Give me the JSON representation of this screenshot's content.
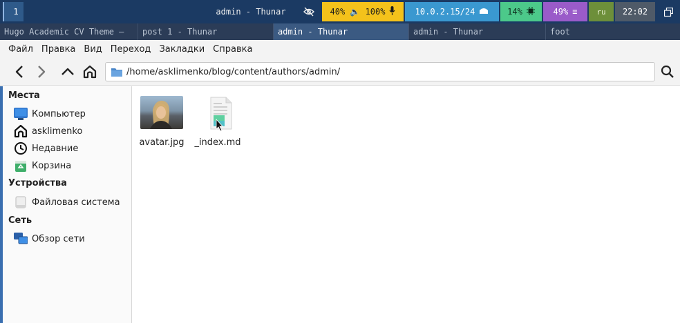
{
  "statusbar": {
    "workspace": "1",
    "window_title": "admin - Thunar",
    "volume": "40% 🔈 100%",
    "network": "10.0.2.15/24",
    "cpu": "14%",
    "memory": "49%",
    "keyboard": "ru",
    "clock": "22:02",
    "colors": {
      "volume": "#f4c21b",
      "network": "#3a98d0",
      "cpu": "#4cc98a",
      "memory": "#9a5bc9"
    }
  },
  "tabs": [
    {
      "label": "Hugo Academic CV Theme —",
      "active": false
    },
    {
      "label": "post 1 - Thunar",
      "active": false
    },
    {
      "label": "admin - Thunar",
      "active": true
    },
    {
      "label": "admin - Thunar",
      "active": false
    },
    {
      "label": "foot",
      "active": false
    }
  ],
  "menu": [
    "Файл",
    "Правка",
    "Вид",
    "Переход",
    "Закладки",
    "Справка"
  ],
  "toolbar": {
    "path": "/home/asklimenko/blog/content/authors/admin/",
    "icons": [
      "back-icon",
      "forward-icon",
      "up-icon",
      "home-icon",
      "folder-icon",
      "search-icon"
    ]
  },
  "sidebar": {
    "places_header": "Места",
    "places": [
      {
        "label": "Компьютер",
        "icon": "computer-icon"
      },
      {
        "label": "asklimenko",
        "icon": "home-icon"
      },
      {
        "label": "Недавние",
        "icon": "clock-icon"
      },
      {
        "label": "Корзина",
        "icon": "trash-icon"
      }
    ],
    "devices_header": "Устройства",
    "devices": [
      {
        "label": "Файловая система",
        "icon": "drive-icon"
      }
    ],
    "network_header": "Сеть",
    "network": [
      {
        "label": "Обзор сети",
        "icon": "network-icon"
      }
    ]
  },
  "files": [
    {
      "name": "avatar.jpg",
      "icon": "image-thumbnail"
    },
    {
      "name": "_index.md",
      "icon": "text-file-icon"
    }
  ]
}
